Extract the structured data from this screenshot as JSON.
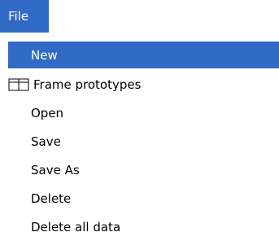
{
  "menu_bar": {
    "file_label": "File"
  },
  "menu": {
    "items": [
      {
        "label": "New",
        "selected": true
      },
      {
        "label": "Frame prototypes",
        "icon": "frame-grid-icon"
      },
      {
        "label": "Open"
      },
      {
        "label": "Save"
      },
      {
        "label": "Save As"
      },
      {
        "label": "Delete"
      },
      {
        "label": "Delete all data"
      }
    ]
  },
  "colors": {
    "selection": "#316ac5",
    "selection_text": "#ffffff",
    "text": "#000000"
  }
}
